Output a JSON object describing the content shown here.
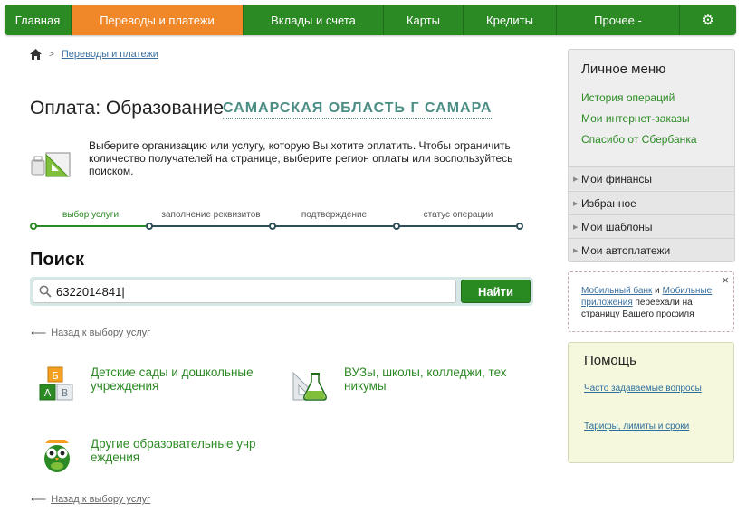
{
  "nav": {
    "home": "Главная",
    "transfers": "Переводы и платежи",
    "deposits": "Вклады и счета",
    "cards": "Карты",
    "credits": "Кредиты",
    "other": "Прочее -",
    "settings_icon": "gear-icon"
  },
  "breadcrumb": {
    "home_icon": "home-icon",
    "link": "Переводы и платежи"
  },
  "page": {
    "title": "Оплата: Образование",
    "region": "САМАРСКАЯ ОБЛАСТЬ Г САМАРА",
    "intro": "Выберите организацию или услугу, которую Вы хотите оплатить. Чтобы ограничить количество получателей на странице, выберите регион оплаты или воспользуйтесь поиском."
  },
  "steps": [
    {
      "label": "выбор услуги",
      "active": true
    },
    {
      "label": "заполнение реквизитов",
      "active": false
    },
    {
      "label": "подтверждение",
      "active": false
    },
    {
      "label": "статус операции",
      "active": false
    }
  ],
  "search": {
    "title": "Поиск",
    "value": "6322014841",
    "button": "Найти"
  },
  "back_link": "Назад к выбору услуг",
  "categories": [
    {
      "label": "Детские сады и дошкольные учреждения",
      "icon": "abc-blocks-icon"
    },
    {
      "label": "ВУЗы, школы, колледжи, техникумы",
      "icon": "flask-icon"
    },
    {
      "label": "Другие образовательные учреждения",
      "icon": "owl-icon"
    }
  ],
  "category_lines": {
    "c1": [
      "Детские сады и дошкольные",
      "учреждения"
    ],
    "c2": [
      "ВУЗы, школы, колледжи, тех",
      "никумы"
    ],
    "c3": [
      "Другие образовательные учр",
      "еждения"
    ]
  },
  "menu": {
    "title": "Личное меню",
    "links": [
      "История операций",
      "Мои интернет-заказы",
      "Спасибо от Сбербанка"
    ],
    "sections": [
      "Мои финансы",
      "Избранное",
      "Мои шаблоны",
      "Мои автоплатежи"
    ]
  },
  "notice": {
    "link1": "Мобильный банк",
    "and": " и ",
    "link2": "Мобильные приложения",
    "rest": " переехали на страницу Вашего профиля",
    "close": "×"
  },
  "help": {
    "title": "Помощь",
    "links": [
      "Часто задаваемые вопросы",
      "Тарифы, лимиты и сроки"
    ]
  },
  "colors": {
    "brand_green": "#2c8a24",
    "active_tab": "#f0882a",
    "region_teal": "#4c8e86",
    "help_bg": "#f5f8dc"
  }
}
